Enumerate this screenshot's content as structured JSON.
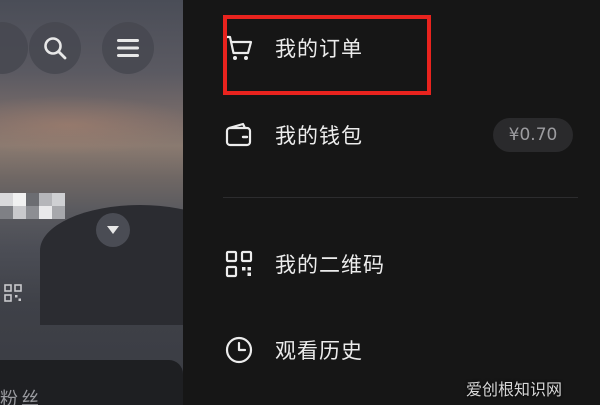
{
  "drawer": {
    "items": [
      {
        "label": "我的订单",
        "icon": "shopping-cart-icon"
      },
      {
        "label": "我的钱包",
        "icon": "wallet-icon",
        "badge": "¥0.70"
      },
      {
        "label": "我的二维码",
        "icon": "qr-code-icon"
      },
      {
        "label": "观看历史",
        "icon": "clock-icon"
      }
    ]
  },
  "left_panel": {
    "fans_label": "粉丝",
    "buttons": [
      "search-icon",
      "menu-icon"
    ]
  },
  "watermark": "爱创根知识网",
  "colors": {
    "drawer_bg": "#161616",
    "highlight": "#e8231e",
    "text": "#ececec",
    "badge_bg": "#2a2a2c"
  }
}
